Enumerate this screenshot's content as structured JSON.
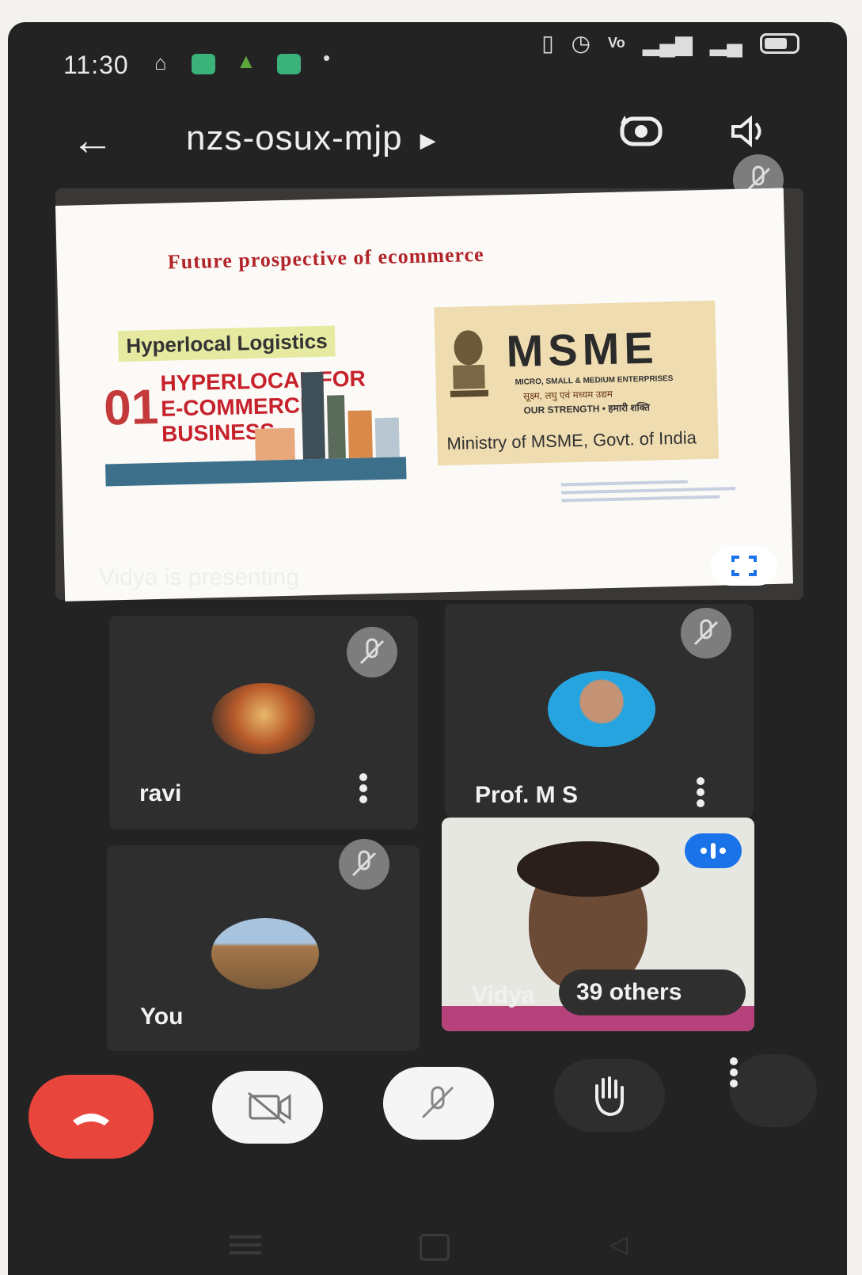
{
  "status_bar": {
    "time": "11:30"
  },
  "app_bar": {
    "meeting_code": "nzs-osux-mjp"
  },
  "presentation": {
    "slide_title": "Future prospective of ecommerce",
    "hyperlocal_heading": "Hyperlocal Logistics",
    "hyperlocal_number": "01",
    "hyperlocal_lines": [
      "HYPERLOCAL FOR",
      "E-COMMERCE",
      "BUSINESS"
    ],
    "msme_logo": "MSME",
    "msme_subtitle": "MICRO, SMALL & MEDIUM ENTERPRISES",
    "msme_hindi": "सूक्ष्म, लघु एवं मध्यम उद्यम",
    "msme_strength": "OUR STRENGTH • हमारी शक्ति",
    "msme_ministry": "Ministry of MSME, Govt. of India",
    "presenting_label": "Vidya is presenting"
  },
  "participants": [
    {
      "name": "ravi",
      "muted": true
    },
    {
      "name": "Prof. M S",
      "muted": true
    },
    {
      "name": "You",
      "muted": true
    },
    {
      "name": "Vidya",
      "muted": false,
      "speaking": true
    }
  ],
  "others_label": "39 others",
  "colors": {
    "end_call": "#e8453c",
    "speaking_badge": "#1a73e8",
    "muted_badge": "#7d7d7d",
    "msme_bg": "#efdcb0",
    "slide_title": "#b2242a"
  },
  "controls": {
    "icons": [
      "end-call-icon",
      "camera-off-icon",
      "mic-off-icon",
      "raise-hand-icon",
      "more-vert-icon"
    ]
  }
}
